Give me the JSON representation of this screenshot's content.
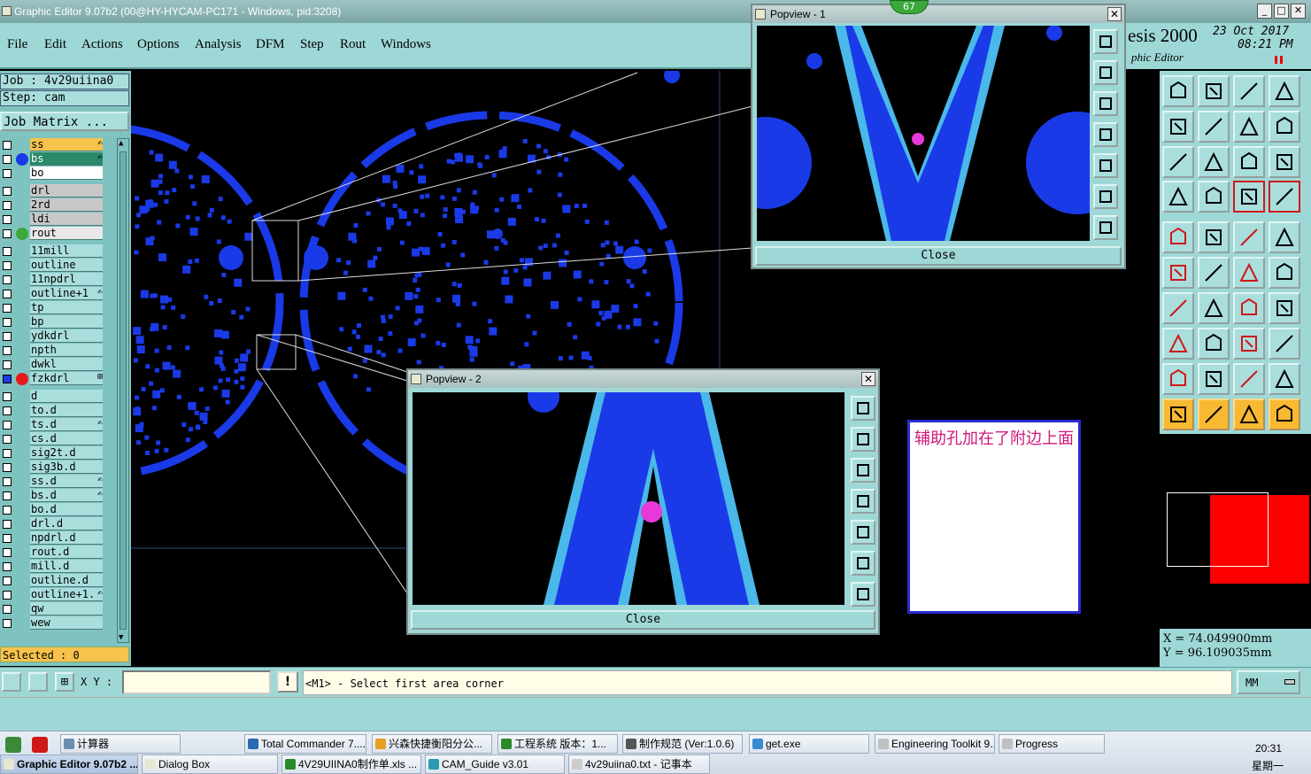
{
  "window": {
    "title": "Graphic Editor 9.07b2 (00@HY-HYCAM-PC171 - Windows, pid:3208)",
    "badge": "67"
  },
  "menu": [
    "File",
    "Edit",
    "Actions",
    "Options",
    "Analysis",
    "DFM",
    "Step",
    "Rout",
    "Windows"
  ],
  "header": {
    "brand": "esis 2000",
    "subtitle": "phic Editor",
    "date": "23 Oct 2017",
    "time": "08:21 PM"
  },
  "job": {
    "job_line": "Job : 4v29uiina0",
    "step_line": "Step: cam",
    "matrix_button": "Job Matrix ..."
  },
  "layers": [
    {
      "name": "ss",
      "color": "#f7c34c",
      "dot": "",
      "edit": true
    },
    {
      "name": "bs",
      "color": "#2a8a6a",
      "dot": "#1a3ae8",
      "edit": true,
      "namecolor": "#fff"
    },
    {
      "name": "bo",
      "color": "#ffffff",
      "dot": "",
      "edit": false
    },
    {
      "name": "drl",
      "color": "#c8c8c8",
      "dot": "",
      "edit": false
    },
    {
      "name": "2rd",
      "color": "#c8c8c8",
      "dot": "",
      "edit": false
    },
    {
      "name": "ldi",
      "color": "#c8c8c8",
      "dot": "",
      "edit": false
    },
    {
      "name": "rout",
      "color": "#e8e8e8",
      "dot": "#3aa83a",
      "edit": false
    },
    {
      "name": "11mill",
      "color": "#a9dedd",
      "dot": "",
      "edit": false
    },
    {
      "name": "outline",
      "color": "#a9dedd",
      "dot": "",
      "edit": false
    },
    {
      "name": "11npdrl",
      "color": "#a9dedd",
      "dot": "",
      "edit": false
    },
    {
      "name": "outline+1",
      "color": "#a9dedd",
      "dot": "",
      "edit": true
    },
    {
      "name": "tp",
      "color": "#a9dedd",
      "dot": "",
      "edit": false
    },
    {
      "name": "bp",
      "color": "#a9dedd",
      "dot": "",
      "edit": false
    },
    {
      "name": "ydkdrl",
      "color": "#a9dedd",
      "dot": "",
      "edit": false
    },
    {
      "name": "npth",
      "color": "#a9dedd",
      "dot": "",
      "edit": false
    },
    {
      "name": "dwkl",
      "color": "#a9dedd",
      "dot": "",
      "edit": false
    },
    {
      "name": "fzkdrl",
      "color": "#a9dedd",
      "dot": "#e81818",
      "edit": false,
      "mark": "⊞"
    },
    {
      "name": "d",
      "color": "#a9dedd",
      "dot": "",
      "edit": false
    },
    {
      "name": "to.d",
      "color": "#a9dedd",
      "dot": "",
      "edit": false
    },
    {
      "name": "ts.d",
      "color": "#a9dedd",
      "dot": "",
      "edit": true
    },
    {
      "name": "cs.d",
      "color": "#a9dedd",
      "dot": "",
      "edit": false
    },
    {
      "name": "sig2t.d",
      "color": "#a9dedd",
      "dot": "",
      "edit": false
    },
    {
      "name": "sig3b.d",
      "color": "#a9dedd",
      "dot": "",
      "edit": false
    },
    {
      "name": "ss.d",
      "color": "#a9dedd",
      "dot": "",
      "edit": true
    },
    {
      "name": "bs.d",
      "color": "#a9dedd",
      "dot": "",
      "edit": true
    },
    {
      "name": "bo.d",
      "color": "#a9dedd",
      "dot": "",
      "edit": false
    },
    {
      "name": "drl.d",
      "color": "#a9dedd",
      "dot": "",
      "edit": false
    },
    {
      "name": "npdrl.d",
      "color": "#a9dedd",
      "dot": "",
      "edit": false
    },
    {
      "name": "rout.d",
      "color": "#a9dedd",
      "dot": "",
      "edit": false
    },
    {
      "name": "mill.d",
      "color": "#a9dedd",
      "dot": "",
      "edit": false
    },
    {
      "name": "outline.d",
      "color": "#a9dedd",
      "dot": "",
      "edit": false
    },
    {
      "name": "outline+1.",
      "color": "#a9dedd",
      "dot": "",
      "edit": true
    },
    {
      "name": "qw",
      "color": "#a9dedd",
      "dot": "",
      "edit": false
    },
    {
      "name": "wew",
      "color": "#a9dedd",
      "dot": "",
      "edit": false
    }
  ],
  "selected_label": "Selected : 0",
  "popview1": {
    "title": "Popview - 1",
    "close": "Close"
  },
  "popview2": {
    "title": "Popview - 2",
    "close": "Close"
  },
  "note_text": "辅助孔加在了附边上面",
  "coords": {
    "x": "X = 74.049900mm",
    "y": "Y = 96.109035mm"
  },
  "cmd": {
    "xy_label": "X Y :",
    "xy_value": "",
    "prompt": "<M1> - Select first area corner",
    "units": "MM"
  },
  "taskbar": {
    "row1": [
      "计算器",
      "Total Commander 7....",
      "兴森快捷衡阳分公...",
      "工程系统  版本：1...",
      "制作规范 (Ver:1.0.6)",
      "get.exe",
      "Engineering Toolkit 9...",
      "Progress"
    ],
    "row2": [
      "Graphic Editor 9.07b2 ...",
      "Dialog Box",
      "4V29UIINA0制作单.xls ...",
      "CAM_Guide v3.01",
      "4v29uiina0.txt - 记事本"
    ],
    "clock": "20:31",
    "weekday": "星期一"
  },
  "colors": {
    "accent": "#9ed8d6",
    "board": "#1a3ae8",
    "trace_edge": "#4ab8e8",
    "drill_mark": "#e838d8"
  }
}
